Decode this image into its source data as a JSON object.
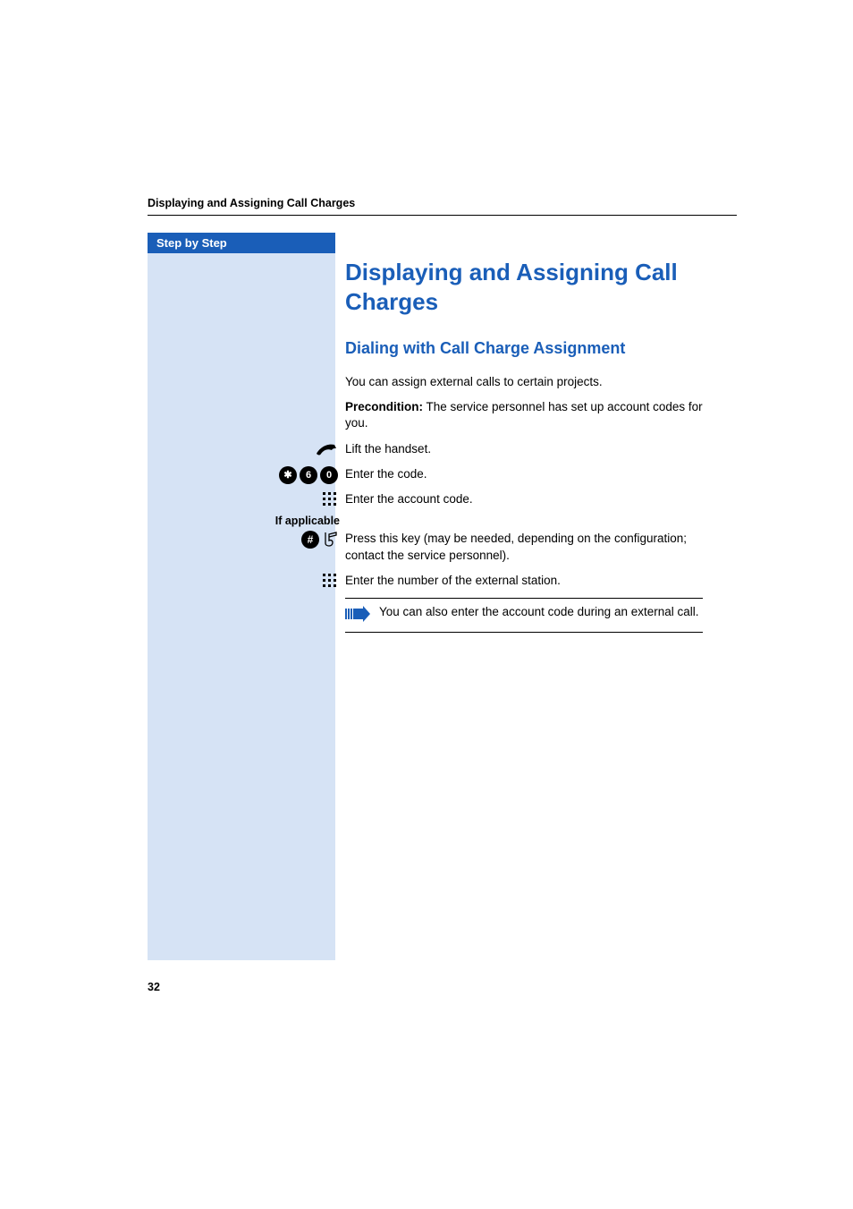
{
  "header": {
    "running_title": "Displaying and Assigning Call Charges"
  },
  "sidebar": {
    "title": "Step by Step"
  },
  "content": {
    "h1": "Displaying and Assigning Call Charges",
    "h2": "Dialing with Call Charge Assignment",
    "intro": "You can assign external calls to certain projects.",
    "precondition_label": "Precondition:",
    "precondition_text": " The service personnel has set up account codes for you.",
    "steps": [
      {
        "icon": "handset",
        "text": "Lift the handset."
      },
      {
        "icon": "keys",
        "keys": [
          "✱",
          "6",
          "0"
        ],
        "text": "Enter the code."
      },
      {
        "icon": "keypad",
        "text": "Enter the account code."
      }
    ],
    "if_applicable_label": "If applicable",
    "optional_step": {
      "icon": "hash-tone",
      "text": "Press this key (may be needed, depending on the configuration; contact the service personnel)."
    },
    "external_step": {
      "icon": "keypad",
      "text": "Enter the number of the external station."
    },
    "note": "You can also enter the account code during an external call."
  },
  "page_number": "32"
}
